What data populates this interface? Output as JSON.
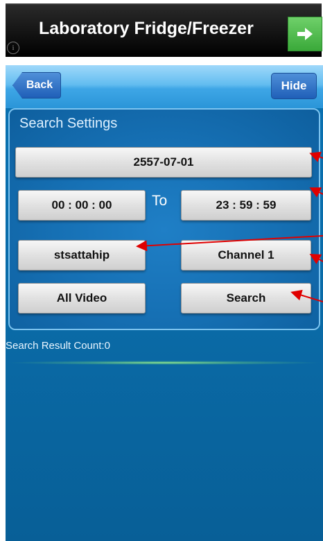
{
  "ad": {
    "title": "Laboratory Fridge/Freezer",
    "info_glyph": "i",
    "arrow_icon": "right-arrow-icon"
  },
  "navbar": {
    "back_label": "Back",
    "hide_label": "Hide"
  },
  "search_settings": {
    "title": "Search Settings",
    "date": "2557-07-01",
    "start_time": "00 : 00 : 00",
    "to_label": "To",
    "end_time": "23 : 59 : 59",
    "site": "stsattahip",
    "channel": "Channel 1",
    "video_type": "All Video",
    "search_label": "Search"
  },
  "result": {
    "count_text": "Search Result Count:0"
  },
  "colors": {
    "accent_blue": "#0a72b2",
    "annotation_arrow": "#e00000",
    "ad_button": "#3aa93a"
  }
}
